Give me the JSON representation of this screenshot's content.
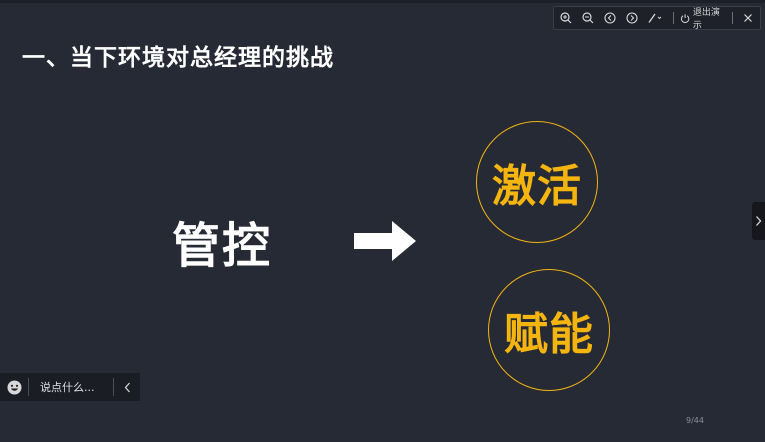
{
  "slide": {
    "title": "一、当下环境对总经理的挑战",
    "left_word": "管控",
    "circle_top": "激活",
    "circle_bottom": "赋能"
  },
  "toolbar": {
    "icons": [
      "zoom-in-icon",
      "zoom-out-icon",
      "prev-icon",
      "next-icon",
      "pen-icon",
      "power-icon",
      "close-icon"
    ],
    "end_label": "退出演示"
  },
  "chat": {
    "placeholder": "说点什么..."
  },
  "page_indicator": "9/44",
  "colors": {
    "background": "#262a35",
    "accent": "#f5b50f",
    "text": "#ffffff"
  }
}
